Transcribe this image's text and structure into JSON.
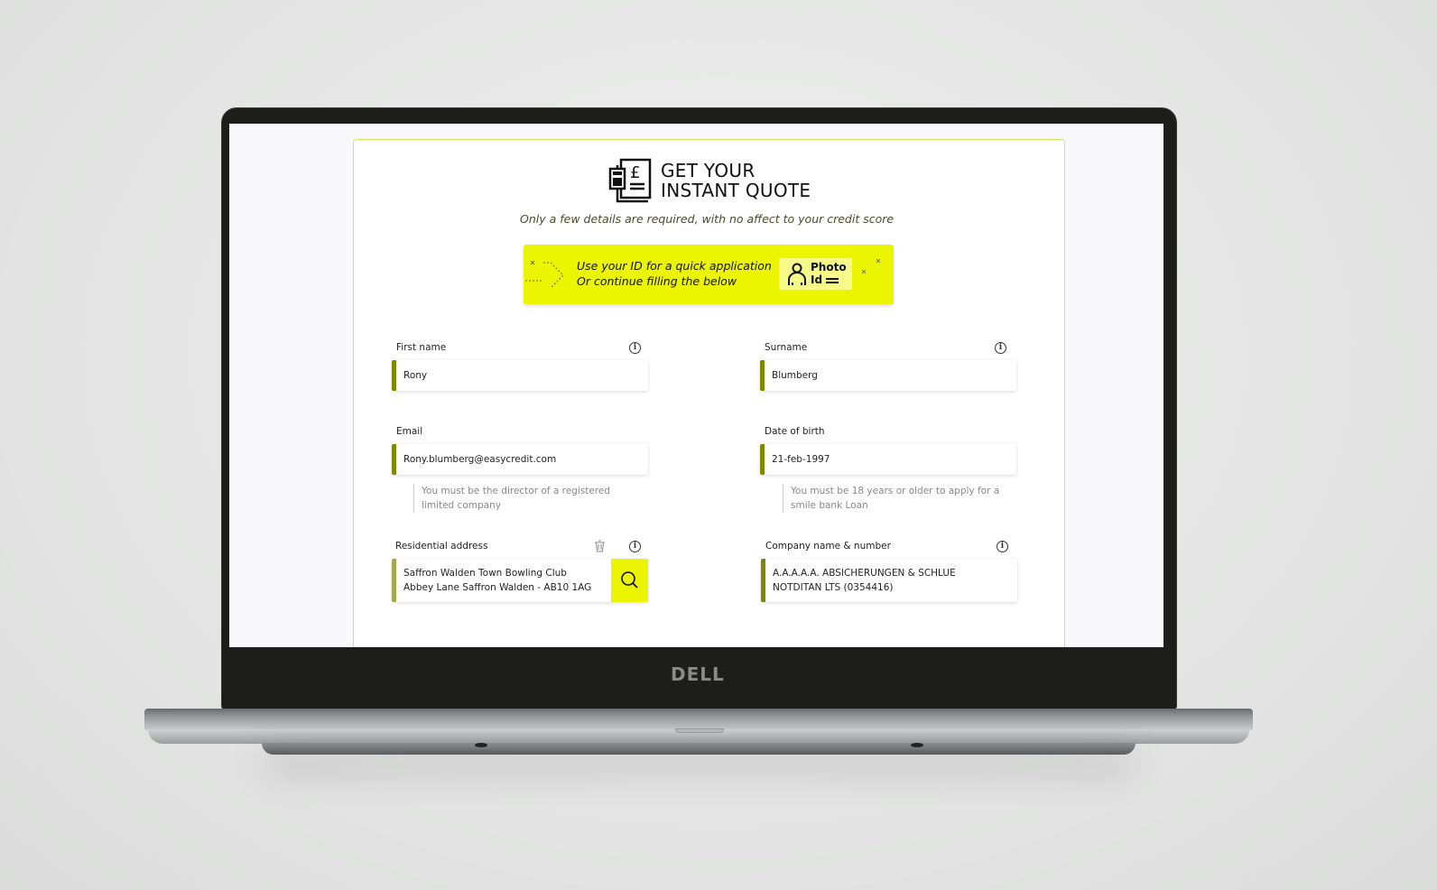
{
  "brand_logo": "DELL",
  "header": {
    "title_line1": "GET YOUR",
    "title_line2": "INSTANT QUOTE",
    "subtitle": "Only a few details are required, with no affect to your credit score"
  },
  "banner": {
    "line1": "Use your ID for a quick application",
    "line2": "Or continue filling the below",
    "photo_id_line1": "Photo",
    "photo_id_line2": "Id",
    "color": "#ecf500"
  },
  "form": {
    "first_name": {
      "label": "First name",
      "value": "Rony"
    },
    "surname": {
      "label": "Surname",
      "value": "Blumberg"
    },
    "email": {
      "label": "Email",
      "value": "Rony.blumberg@easycredit.com",
      "hint": "You must be the director of a registered limited company"
    },
    "dob": {
      "label": "Date of birth",
      "value": "21-feb-1997",
      "hint": "You must be 18 years or older to apply for a smile bank Loan"
    },
    "address": {
      "label": "Residential address",
      "line1": "Saffron Walden Town Bowling Club",
      "line2": "Abbey Lane Saffron Walden - AB10 1AG"
    },
    "company": {
      "label": "Company name & number",
      "line1": "A.A.A.A.A. ABSICHERUNGEN & SCHLUE",
      "line2": "NOTDITAN LTS (0354416)"
    }
  },
  "accent_color": "#7d8a00"
}
